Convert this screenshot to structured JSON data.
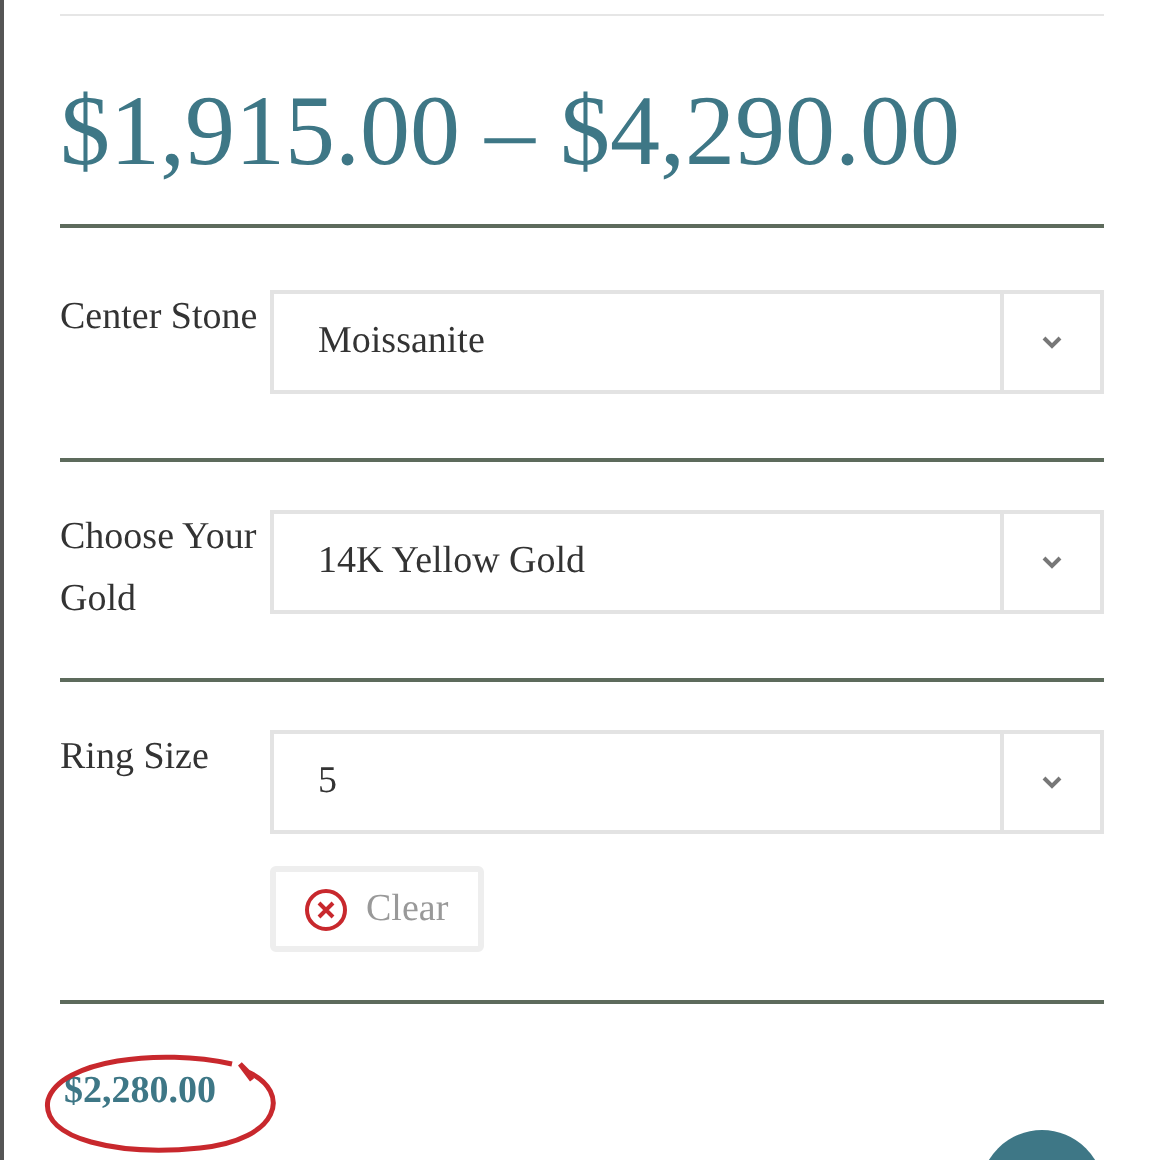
{
  "price_range": "$1,915.00 – $4,290.00",
  "options": [
    {
      "label": "Center Stone",
      "value": "Moissanite"
    },
    {
      "label": "Choose Your Gold",
      "value": "14K Yellow Gold"
    },
    {
      "label": "Ring Size",
      "value": "5"
    }
  ],
  "clear_button": {
    "label": "Clear"
  },
  "selected_price": "$2,280.00"
}
